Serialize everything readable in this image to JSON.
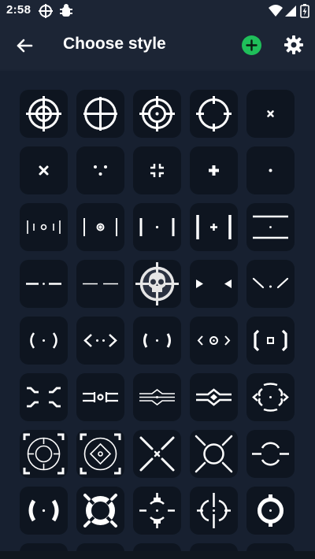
{
  "status_bar": {
    "time": "2:58",
    "icons": [
      "crosshair-icon",
      "bug-icon",
      "wifi-icon",
      "signal-icon",
      "battery-charging-icon"
    ]
  },
  "app_bar": {
    "title": "Choose style",
    "back_icon": "arrow-left-icon",
    "add_icon": "plus-circle-icon",
    "settings_icon": "gear-icon"
  },
  "colors": {
    "background": "#1b2433",
    "tile": "#0e1520",
    "accent_add": "#1fbf5a",
    "glyph": "#ffffff"
  },
  "crosshair_styles": [
    [
      "ring-crosshair",
      "circle-crosshair",
      "ring-dot-crosshair",
      "open-circle-crosshair",
      "small-x-crosshair"
    ],
    [
      "x-crosshair",
      "three-dots-crosshair",
      "corner-brackets-crosshair",
      "plus-crosshair",
      "dot-crosshair"
    ],
    [
      "bars-ring-crosshair",
      "bars-dotring-crosshair",
      "bars-dot-crosshair",
      "bars-plus-crosshair",
      "horizontal-lines-crosshair"
    ],
    [
      "dashes-dot-crosshair",
      "long-dashes-crosshair",
      "skull-scope-crosshair",
      "arrows-crosshair",
      "chevron-down-crosshair"
    ],
    [
      "parentheses-dot-crosshair",
      "angle-brackets-dots-crosshair",
      "brackets-dot-crosshair",
      "angle-ring-crosshair",
      "brackets-square-crosshair"
    ],
    [
      "curly-brackets-crosshair",
      "slider-crosshair",
      "diamond-lines-crosshair",
      "double-diamond-crosshair",
      "split-ring-crosshair"
    ],
    [
      "reticle-ring-crosshair",
      "reticle-diamond-crosshair",
      "diagonal-x-crosshair",
      "split-x-ring-crosshair",
      "horizontal-ring-crosshair"
    ],
    [
      "thick-parentheses-crosshair",
      "lifebuoy-crosshair",
      "gun-sight-crosshair",
      "vertical-sight-crosshair",
      "bold-ring-crosshair"
    ]
  ]
}
